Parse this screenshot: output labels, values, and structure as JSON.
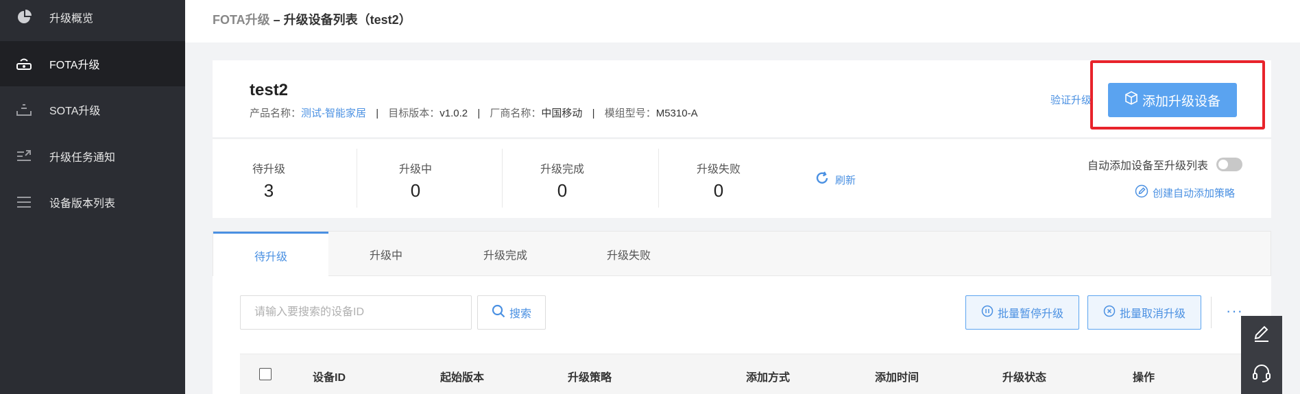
{
  "sidebar": {
    "items": [
      {
        "label": "升级概览",
        "icon": "pie-chart-icon"
      },
      {
        "label": "FOTA升级",
        "icon": "router-icon",
        "active": true
      },
      {
        "label": "SOTA升级",
        "icon": "tray-icon"
      },
      {
        "label": "升级任务通知",
        "icon": "notice-icon"
      },
      {
        "label": "设备版本列表",
        "icon": "list-icon"
      }
    ]
  },
  "header": {
    "crumb_root": "FOTA升级",
    "crumb_sep": " – ",
    "crumb_current": "升级设备列表（test2）"
  },
  "product": {
    "name": "test2",
    "meta": [
      {
        "label": "产品名称：",
        "value": "测试-智能家居"
      },
      {
        "label": "目标版本：",
        "value": "v1.0.2"
      },
      {
        "label": "厂商名称：",
        "value": "中国移动"
      },
      {
        "label": "模组型号：",
        "value": "M5310-A"
      }
    ],
    "separator": "|",
    "verify_label": "验证升级",
    "add_button_label": "添加升级设备"
  },
  "stats": {
    "items": [
      {
        "label": "待升级",
        "value": "3"
      },
      {
        "label": "升级中",
        "value": "0"
      },
      {
        "label": "升级完成",
        "value": "0"
      },
      {
        "label": "升级失败",
        "value": "0"
      }
    ],
    "refresh_label": "刷新",
    "auto_add_label": "自动添加设备至升级列表",
    "auto_add_enabled": false,
    "create_policy_label": "创建自动添加策略"
  },
  "tabs": [
    {
      "label": "待升级",
      "active": true
    },
    {
      "label": "升级中"
    },
    {
      "label": "升级完成"
    },
    {
      "label": "升级失败"
    }
  ],
  "toolbar": {
    "search_placeholder": "请输入要搜索的设备ID",
    "search_label": "搜索",
    "pause_label": "批量暂停升级",
    "cancel_label": "批量取消升级",
    "more_label": "···"
  },
  "table": {
    "columns": [
      "设备ID",
      "起始版本",
      "升级策略",
      "添加方式",
      "添加时间",
      "升级状态",
      "操作"
    ]
  },
  "colors": {
    "accent": "#4a90e2",
    "primary_button": "#5aa3f0",
    "highlight_box": "#e8232b",
    "sidebar_bg": "#2b2d33"
  }
}
